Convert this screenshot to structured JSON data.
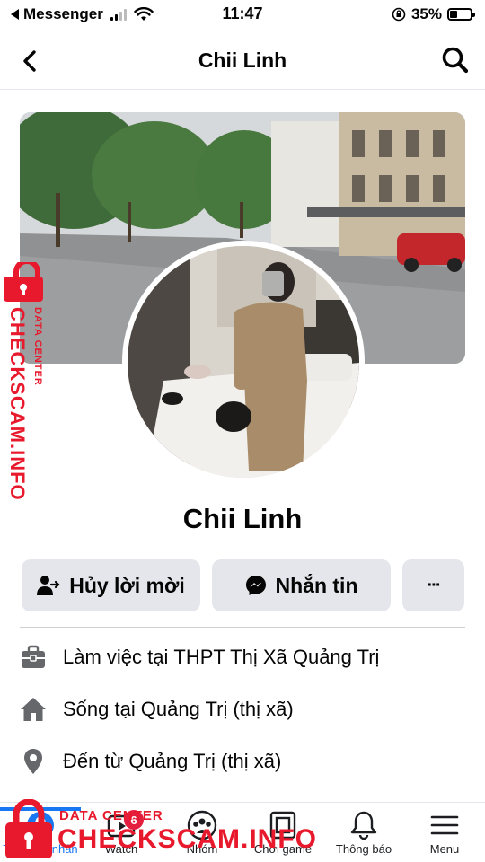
{
  "status_bar": {
    "carrier": "Messenger",
    "time": "11:47",
    "battery": "35%",
    "battery_level": 0.35
  },
  "header": {
    "title": "Chii Linh",
    "back_icon": "chevron-left-icon",
    "search_icon": "search-icon"
  },
  "profile": {
    "name": "Chii Linh"
  },
  "actions": {
    "cancel_request": "Hủy lời mời",
    "message": "Nhắn tin",
    "more": "···"
  },
  "intro": [
    {
      "icon": "briefcase-icon",
      "prefix": "Làm việc tại",
      "value": "THPT Thị Xã Quảng Trị"
    },
    {
      "icon": "home-icon",
      "prefix": "Sống tại",
      "value": "Quảng Trị (thị xã)"
    },
    {
      "icon": "location-pin-icon",
      "prefix": "Đến từ",
      "value": "Quảng Trị (thị xã)"
    }
  ],
  "bottom_nav": {
    "tabs": [
      {
        "label": "Trang cá nhân",
        "icon": "profile-icon",
        "active": true
      },
      {
        "label": "Watch",
        "icon": "watch-icon",
        "active": false
      },
      {
        "label": "Nhóm",
        "icon": "groups-icon",
        "active": false
      },
      {
        "label": "Chơi game",
        "icon": "gaming-icon",
        "active": false
      },
      {
        "label": "Thông báo",
        "icon": "bell-icon",
        "active": false
      },
      {
        "label": "Menu",
        "icon": "menu-icon",
        "active": false
      }
    ],
    "watch_badge": "6"
  },
  "watermark": {
    "title": "DATA CENTER",
    "site": "CHECKSCAM.INFO"
  },
  "colors": {
    "accent": "#1877f2",
    "button_bg": "#e4e6eb",
    "watermark": "#e8192c"
  }
}
